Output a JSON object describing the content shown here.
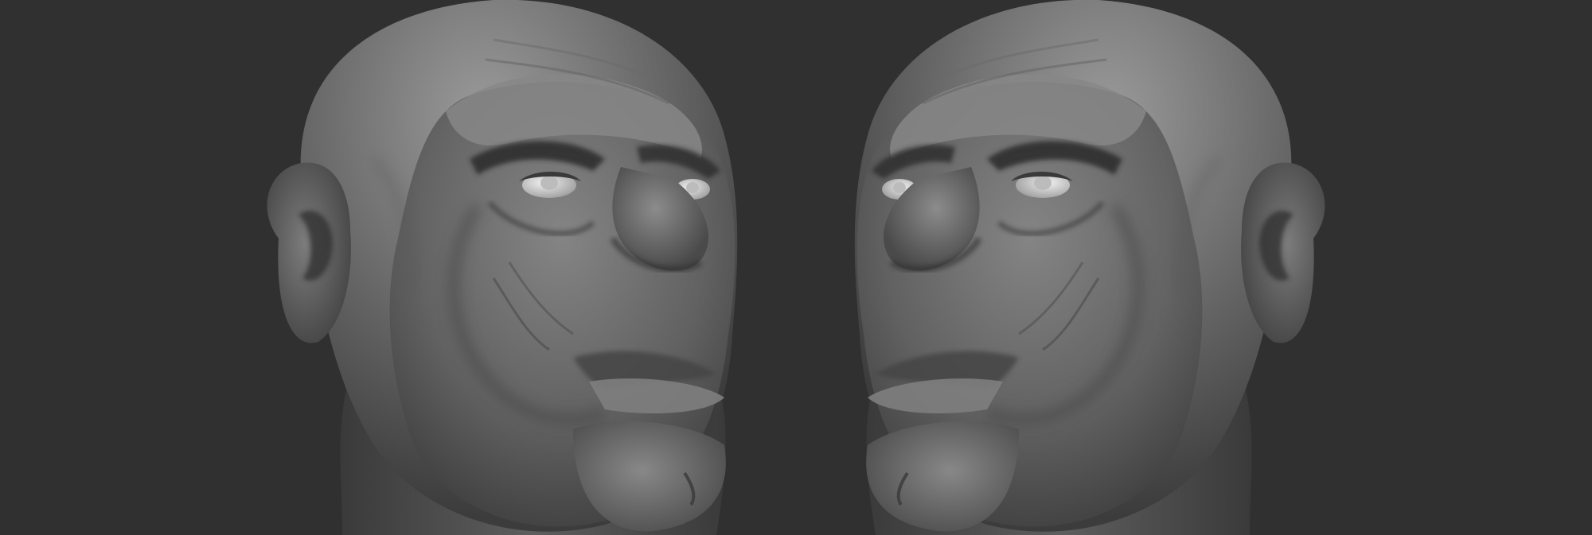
{
  "scene": {
    "background_color": "#303030",
    "clay_base_color": "#6e6e6e",
    "clay_shadow_color": "#3a3a3a",
    "clay_highlight_color": "#9a9a9a",
    "eye_color": "#d4d4d4",
    "views": [
      {
        "name": "head-three-quarter-left",
        "facing": "right",
        "subject": "bald-head-sculpt"
      },
      {
        "name": "head-three-quarter-right",
        "facing": "left",
        "subject": "bald-head-sculpt"
      }
    ]
  }
}
